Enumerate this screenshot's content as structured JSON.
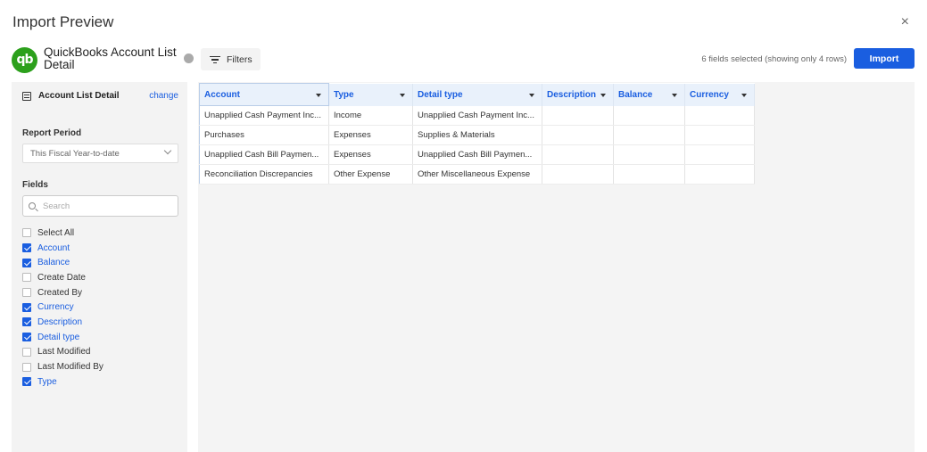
{
  "header": {
    "title": "Import Preview",
    "close_glyph": "×"
  },
  "report": {
    "logo_text": "qb",
    "name": "QuickBooks Account List Detail"
  },
  "toolbar": {
    "filters_label": "Filters",
    "fields_count": "6 fields selected (showing only 4 rows)",
    "import_label": "Import"
  },
  "sidebar": {
    "list_title": "Account List Detail",
    "change_label": "change",
    "report_period_label": "Report Period",
    "report_period_value": "This Fiscal Year-to-date",
    "fields_label": "Fields",
    "search_placeholder": "Search",
    "fields": [
      {
        "label": "Select All",
        "checked": false
      },
      {
        "label": "Account",
        "checked": true
      },
      {
        "label": "Balance",
        "checked": true
      },
      {
        "label": "Create Date",
        "checked": false
      },
      {
        "label": "Created By",
        "checked": false
      },
      {
        "label": "Currency",
        "checked": true
      },
      {
        "label": "Description",
        "checked": true
      },
      {
        "label": "Detail type",
        "checked": true
      },
      {
        "label": "Last Modified",
        "checked": false
      },
      {
        "label": "Last Modified By",
        "checked": false
      },
      {
        "label": "Type",
        "checked": true
      }
    ]
  },
  "table": {
    "columns": [
      "Account",
      "Type",
      "Detail type",
      "Description",
      "Balance",
      "Currency"
    ],
    "rows": [
      [
        "Unapplied Cash Payment Inc...",
        "Income",
        "Unapplied Cash Payment Inc...",
        "",
        "",
        ""
      ],
      [
        "Purchases",
        "Expenses",
        "Supplies & Materials",
        "",
        "",
        ""
      ],
      [
        "Unapplied Cash Bill Paymen...",
        "Expenses",
        "Unapplied Cash Bill Paymen...",
        "",
        "",
        ""
      ],
      [
        "Reconciliation Discrepancies",
        "Other Expense",
        "Other Miscellaneous Expense",
        "",
        "",
        ""
      ]
    ]
  },
  "colors": {
    "accent": "#1a5ee0",
    "qb_green": "#2ca01c"
  }
}
